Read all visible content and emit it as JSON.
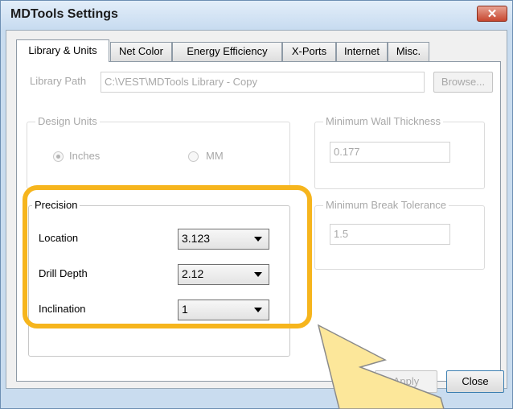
{
  "window": {
    "title": "MDTools Settings",
    "close_glyph": "✕"
  },
  "tabs": [
    {
      "label": "Library & Units",
      "active": true
    },
    {
      "label": "Net Color"
    },
    {
      "label": "Energy Efficiency"
    },
    {
      "label": "X-Ports"
    },
    {
      "label": "Internet"
    },
    {
      "label": "Misc."
    }
  ],
  "library": {
    "label": "Library Path",
    "value": "C:\\VEST\\MDTools Library - Copy",
    "browse": "Browse..."
  },
  "design_units": {
    "title": "Design Units",
    "options": [
      "Inches",
      "MM"
    ],
    "selected": "Inches"
  },
  "min_wall": {
    "title": "Minimum Wall Thickness",
    "value": "0.177"
  },
  "min_break": {
    "title": "Minimum Break Tolerance",
    "value": "1.5"
  },
  "precision": {
    "title": "Precision",
    "rows": [
      {
        "label": "Location",
        "value": "3.123"
      },
      {
        "label": "Drill Depth",
        "value": "2.12"
      },
      {
        "label": "Inclination",
        "value": "1"
      }
    ]
  },
  "footer": {
    "apply": "Apply",
    "close": "Close"
  },
  "annotation": {
    "highlight_color": "#f6b51d",
    "arrow_color": "#fce79a"
  }
}
